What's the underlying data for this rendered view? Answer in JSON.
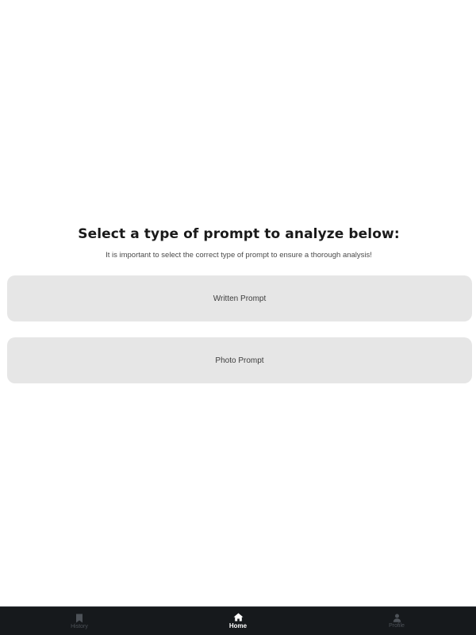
{
  "main": {
    "title": "Select a type of prompt to analyze below:",
    "subtitle": "It is important to select the correct type of prompt to ensure a thorough analysis!",
    "options": [
      {
        "label": "Written Prompt"
      },
      {
        "label": "Photo Prompt"
      }
    ]
  },
  "tabbar": {
    "tabs": [
      {
        "label": "History",
        "icon": "bookmark-icon",
        "active": false
      },
      {
        "label": "Home",
        "icon": "home-icon",
        "active": true
      },
      {
        "label": "Profile",
        "icon": "person-icon",
        "active": false
      }
    ],
    "background": "#16191c",
    "active_color": "#ffffff",
    "inactive_color": "#4d5258"
  }
}
